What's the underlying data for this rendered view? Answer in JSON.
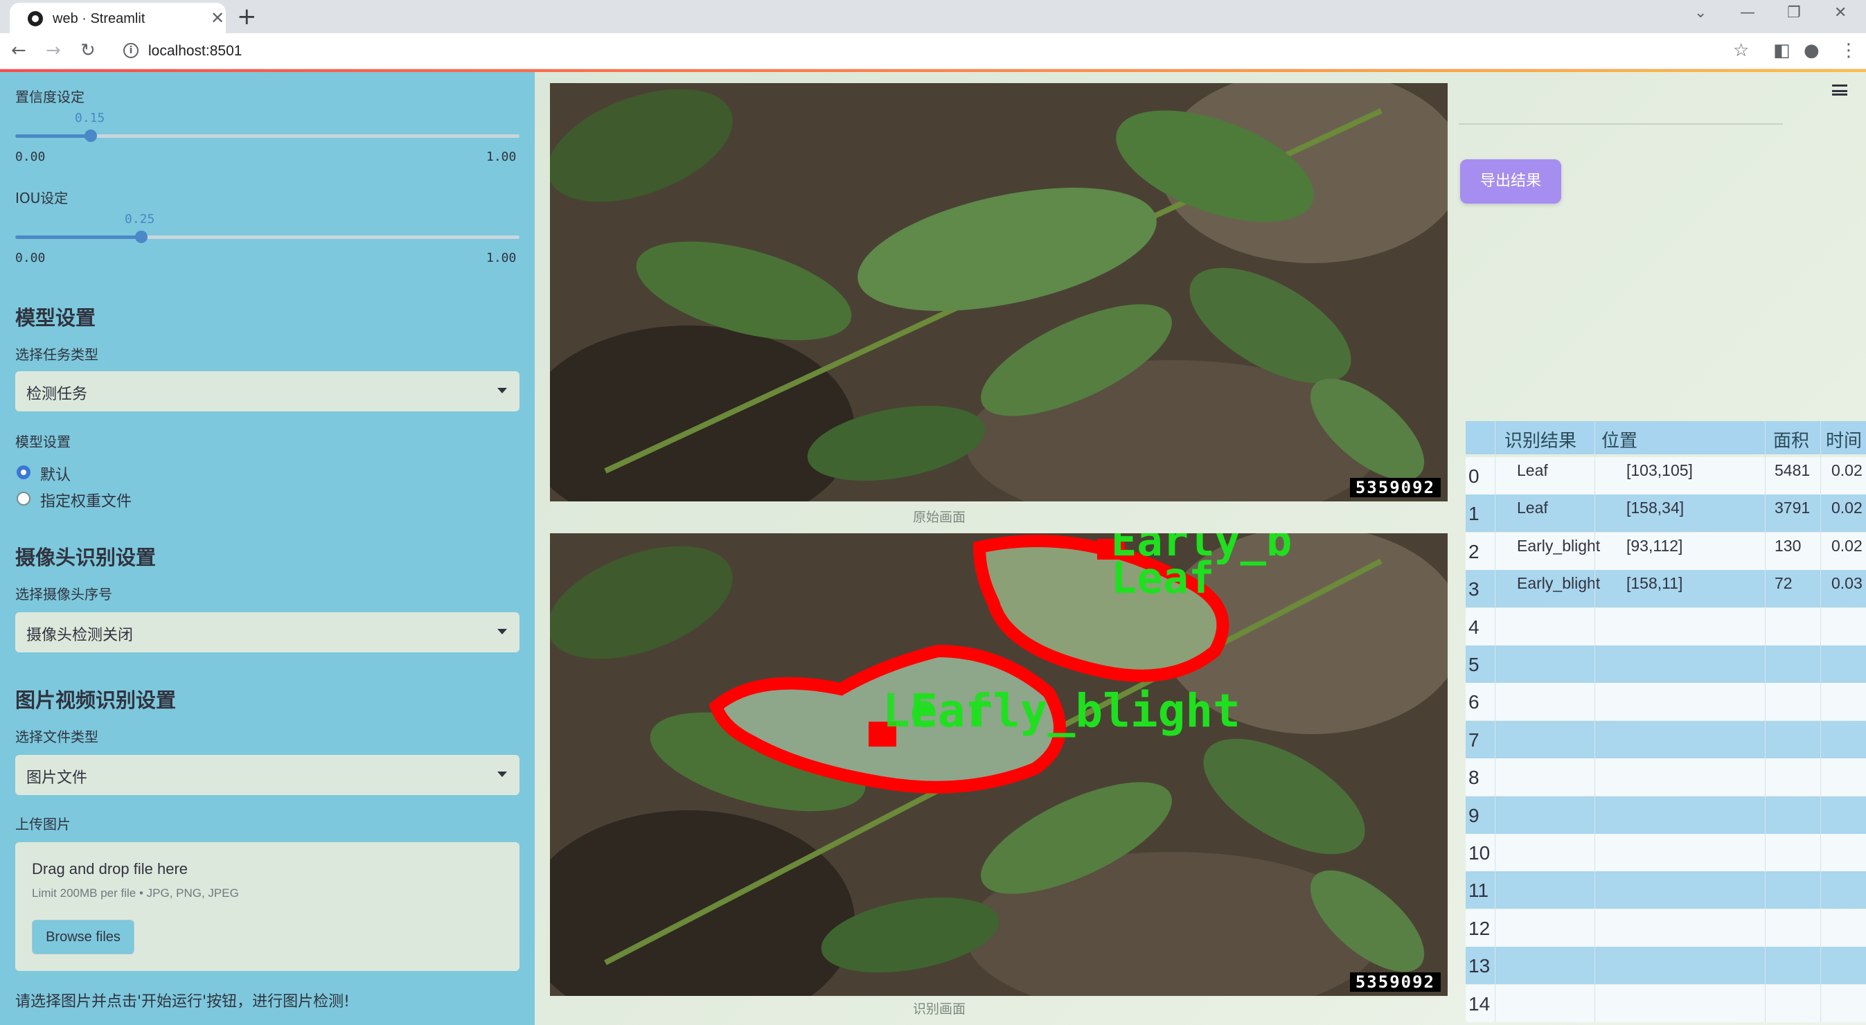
{
  "browser": {
    "tab_title": "web · Streamlit",
    "url": "localhost:8501"
  },
  "sidebar": {
    "confidence": {
      "label": "置信度设定",
      "value": "0.15",
      "min": "0.00",
      "max": "1.00",
      "fraction": 0.15
    },
    "iou": {
      "label": "IOU设定",
      "value": "0.25",
      "min": "0.00",
      "max": "1.00",
      "fraction": 0.25
    },
    "model_heading": "模型设置",
    "task_label": "选择任务类型",
    "task_value": "检测任务",
    "model_label": "模型设置",
    "model_options": [
      "默认",
      "指定权重文件"
    ],
    "model_selected": 0,
    "camera_heading": "摄像头识别设置",
    "camera_label": "选择摄像头序号",
    "camera_value": "摄像头检测关闭",
    "media_heading": "图片视频识别设置",
    "filetype_label": "选择文件类型",
    "filetype_value": "图片文件",
    "upload_label": "上传图片",
    "upload_title": "Drag and drop file here",
    "upload_limit": "Limit 200MB per file • JPG, PNG, JPEG",
    "browse_button": "Browse files",
    "footer_hint": "请选择图片并点击'开始运行'按钮，进行图片检测!"
  },
  "main": {
    "original_caption": "原始画面",
    "result_caption": "识别画面",
    "watermark": "5359092",
    "detection_labels": [
      "Early_b",
      "Leaf",
      "Leaf",
      "Early_blight"
    ],
    "export_button": "导出结果"
  },
  "table": {
    "headers": [
      "识别结果",
      "位置",
      "面积",
      "时间"
    ],
    "rows": [
      {
        "idx": "0",
        "result": "Leaf",
        "pos": "[103,105]",
        "area": "5481",
        "time": "0.02"
      },
      {
        "idx": "1",
        "result": "Leaf",
        "pos": "[158,34]",
        "area": "3791",
        "time": "0.02"
      },
      {
        "idx": "2",
        "result": "Early_blight",
        "pos": "[93,112]",
        "area": "130",
        "time": "0.02"
      },
      {
        "idx": "3",
        "result": "Early_blight",
        "pos": "[158,11]",
        "area": "72",
        "time": "0.03"
      },
      {
        "idx": "4",
        "result": "",
        "pos": "",
        "area": "",
        "time": ""
      },
      {
        "idx": "5",
        "result": "",
        "pos": "",
        "area": "",
        "time": ""
      },
      {
        "idx": "6",
        "result": "",
        "pos": "",
        "area": "",
        "time": ""
      },
      {
        "idx": "7",
        "result": "",
        "pos": "",
        "area": "",
        "time": ""
      },
      {
        "idx": "8",
        "result": "",
        "pos": "",
        "area": "",
        "time": ""
      },
      {
        "idx": "9",
        "result": "",
        "pos": "",
        "area": "",
        "time": ""
      },
      {
        "idx": "10",
        "result": "",
        "pos": "",
        "area": "",
        "time": ""
      },
      {
        "idx": "11",
        "result": "",
        "pos": "",
        "area": "",
        "time": ""
      },
      {
        "idx": "12",
        "result": "",
        "pos": "",
        "area": "",
        "time": ""
      },
      {
        "idx": "13",
        "result": "",
        "pos": "",
        "area": "",
        "time": ""
      },
      {
        "idx": "14",
        "result": "",
        "pos": "",
        "area": "",
        "time": ""
      }
    ]
  },
  "colors": {
    "sidebar_bg": "#7dc8dc",
    "accent": "#4a88c7",
    "export_button": "#a58ef0",
    "box_red": "#ff0000",
    "label_green": "#1fe01f"
  }
}
